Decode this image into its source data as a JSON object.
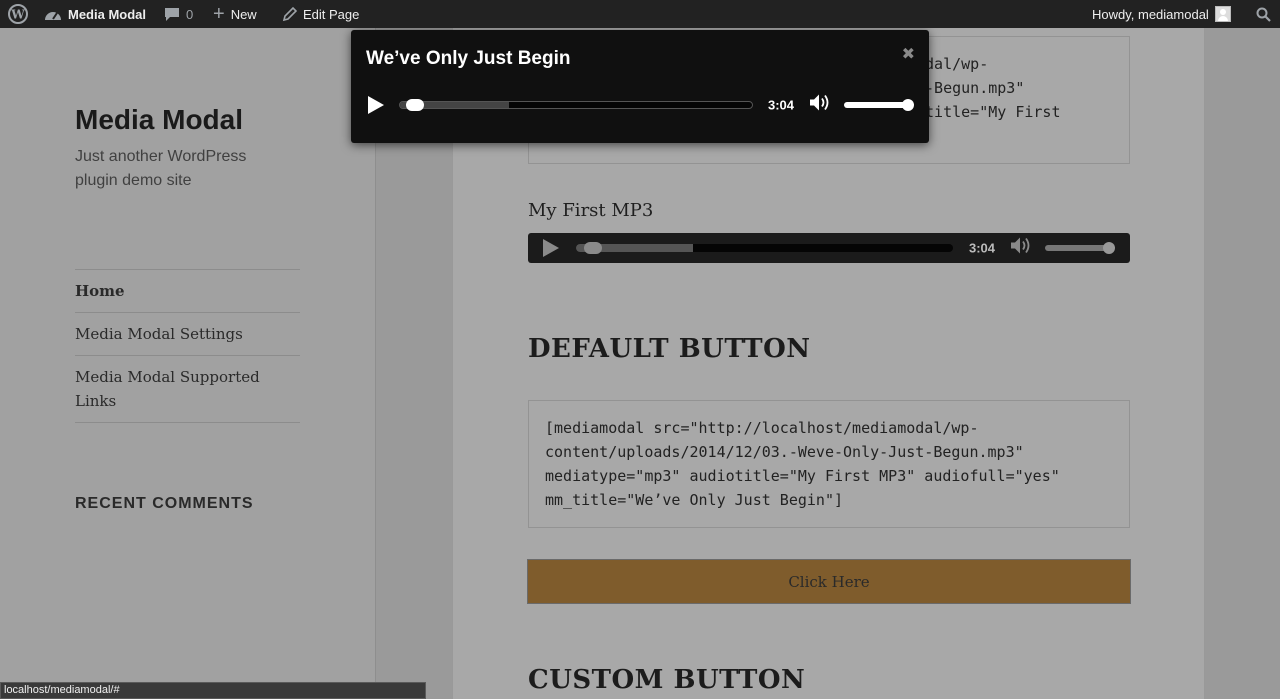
{
  "admin_bar": {
    "site_name": "Media Modal",
    "comments_count": "0",
    "new_label": "New",
    "edit_label": "Edit Page",
    "greeting": "Howdy, mediamodal"
  },
  "sidebar": {
    "site_title": "Media Modal",
    "site_description": "Just another WordPress plugin demo site",
    "nav": [
      {
        "label": "Home"
      },
      {
        "label": "Media Modal Settings"
      },
      {
        "label": "Media Modal Supported Links"
      }
    ],
    "recent_comments_title": "RECENT COMMENTS"
  },
  "content": {
    "top_code_lines": [
      "odal/wp-",
      "t-Begun.mp3\"",
      "otitle=\"My First"
    ],
    "mp3_title": "My First MP3",
    "inline_player": {
      "time": "3:04",
      "progress": 0.02,
      "buffered": 0.31,
      "volume": 1.0
    },
    "default_heading": "DEFAULT BUTTON",
    "code_lines": [
      "[mediamodal src=\"http://localhost/mediamodal/wp-",
      "content/uploads/2014/12/03.-Weve-Only-Just-Begun.mp3\"",
      "mediatype=\"mp3\" audiotitle=\"My First MP3\" audiofull=\"yes\"",
      "mm_title=\"We’ve Only Just Begin\"]"
    ],
    "button_label": "Click Here",
    "custom_heading": "CUSTOM BUTTON"
  },
  "modal": {
    "title": "We’ve Only Just Begin",
    "close_symbol": "✖",
    "player": {
      "time": "3:04",
      "progress": 0.02,
      "buffered": 0.31,
      "volume": 1.0
    }
  },
  "status_bar": {
    "url": "localhost/mediamodal/#"
  },
  "colors": {
    "admin_bar_bg": "#222222",
    "overlay_sidebar": "#a1a1a1",
    "overlay_content": "#a8a8a8",
    "button_bg": "#7f5c2c",
    "modal_bg": "#101010"
  },
  "icons": {
    "wordpress": "wordpress-logo-icon",
    "dashboard": "dashboard-icon",
    "comments": "comment-icon",
    "new": "plus-icon",
    "edit": "pencil-icon",
    "avatar": "avatar-icon",
    "search": "search-icon",
    "play": "play-icon",
    "volume": "volume-icon",
    "close": "close-icon"
  }
}
